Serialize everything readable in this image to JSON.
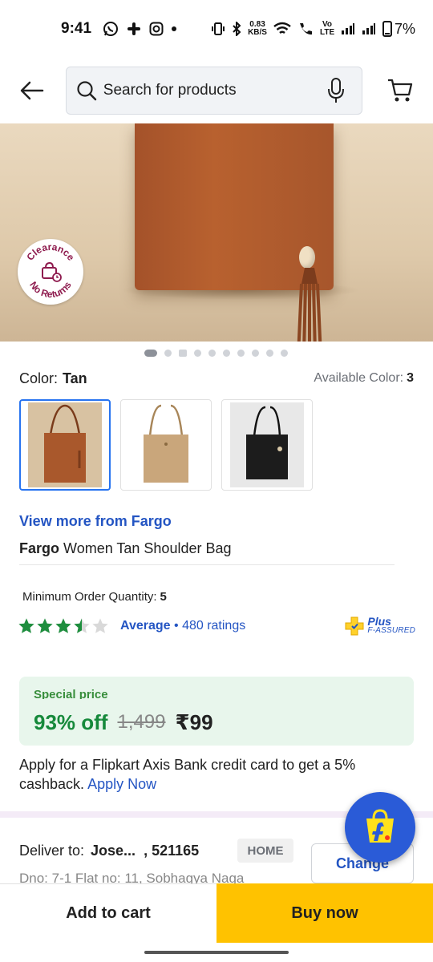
{
  "status_bar": {
    "time": "9:41",
    "net_speed_top": "0.83",
    "net_speed_bottom": "KB/S",
    "volte": "Vo LTE",
    "battery": "7%"
  },
  "header": {
    "search_placeholder": "Search for products"
  },
  "image_badge": {
    "line1": "Clearance",
    "line2": "No Returns",
    "color": "#8e1b4e"
  },
  "color_section": {
    "label": "Color:",
    "selected": "Tan",
    "available_label": "Available Color:",
    "available_count": "3",
    "swatches": [
      {
        "name": "Tan",
        "color": "#a9582c"
      },
      {
        "name": "Beige",
        "color": "#c9a67b"
      },
      {
        "name": "Black",
        "color": "#1c1c1c"
      }
    ]
  },
  "product": {
    "view_more": "View more from Fargo",
    "brand": "Fargo",
    "title": "Women Tan Shoulder Bag",
    "moq_label": "Minimum Order Quantity:",
    "moq_value": "5",
    "rating_value": 3.5,
    "rating_label": "Average",
    "rating_separator": " • ",
    "ratings_count": "480 ratings",
    "plus_title": "Plus",
    "plus_sub": "F-ASSURED"
  },
  "price": {
    "special_label": "Special price",
    "discount": "93% off",
    "mrp": "1,499",
    "final": "₹99"
  },
  "offer": {
    "text": "Apply for a Flipkart Axis Bank credit card to get a 5% cashback.",
    "link": "Apply Now"
  },
  "delivery": {
    "label": "Deliver to:",
    "name": "Jose...",
    "pincode": ", 521165",
    "tag": "HOME",
    "address": "Dno: 7-1 Flat no: 11, Sobhagya Naga",
    "change_label": "Change"
  },
  "actions": {
    "add_to_cart": "Add to cart",
    "buy_now": "Buy now"
  },
  "colors": {
    "link_blue": "#2455c3",
    "green": "#16893b",
    "buy_yellow": "#ffc200",
    "star_green": "#1e8e3e"
  }
}
